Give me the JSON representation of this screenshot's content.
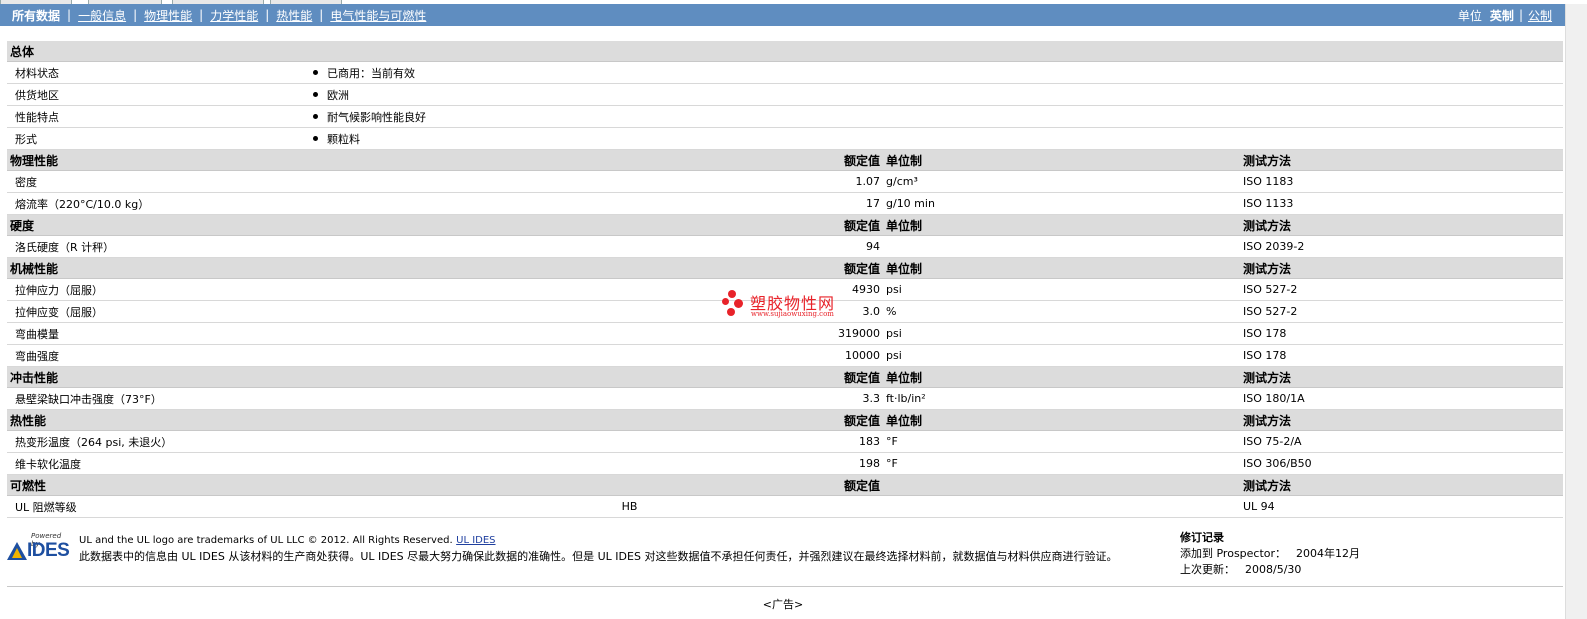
{
  "nav": {
    "tabs": [
      "所有数据",
      "一般信息",
      "物理性能",
      "力学性能",
      "热性能",
      "电气性能与可燃性"
    ],
    "units_label": "单位",
    "unit_current": "英制",
    "unit_other": "公制"
  },
  "sections": [
    {
      "title": "总体",
      "headers": null,
      "rows": [
        {
          "label": "材料状态",
          "bullet": "已商用：当前有效"
        },
        {
          "label": "供货地区",
          "bullet": "欧洲"
        },
        {
          "label": "性能特点",
          "bullet": "耐气候影响性能良好"
        },
        {
          "label": "形式",
          "bullet": "颗粒料"
        }
      ]
    },
    {
      "title": "物理性能",
      "headers": {
        "value": "额定值",
        "unit": "单位制",
        "method": "测试方法"
      },
      "rows": [
        {
          "label": "密度",
          "value": "1.07",
          "unit": "g/cm³",
          "method": "ISO 1183"
        },
        {
          "label": "熔流率（220°C/10.0 kg）",
          "value": "17",
          "unit": "g/10 min",
          "method": "ISO 1133"
        }
      ]
    },
    {
      "title": "硬度",
      "headers": {
        "value": "额定值",
        "unit": "单位制",
        "method": "测试方法"
      },
      "rows": [
        {
          "label": "洛氏硬度（R 计秤）",
          "value": "94",
          "unit": "",
          "method": "ISO 2039-2"
        }
      ]
    },
    {
      "title": "机械性能",
      "headers": {
        "value": "额定值",
        "unit": "单位制",
        "method": "测试方法"
      },
      "rows": [
        {
          "label": "拉伸应力（屈服）",
          "value": "4930",
          "unit": "psi",
          "method": "ISO 527-2"
        },
        {
          "label": "拉伸应变（屈服）",
          "value": "3.0",
          "unit": "%",
          "method": "ISO 527-2"
        },
        {
          "label": "弯曲模量",
          "value": "319000",
          "unit": "psi",
          "method": "ISO 178"
        },
        {
          "label": "弯曲强度",
          "value": "10000",
          "unit": "psi",
          "method": "ISO 178"
        }
      ]
    },
    {
      "title": "冲击性能",
      "headers": {
        "value": "额定值",
        "unit": "单位制",
        "method": "测试方法"
      },
      "rows": [
        {
          "label": "悬壁梁缺口冲击强度（73°F）",
          "value": "3.3",
          "unit": "ft·lb/in²",
          "method": "ISO 180/1A"
        }
      ]
    },
    {
      "title": "热性能",
      "headers": {
        "value": "额定值",
        "unit": "单位制",
        "method": "测试方法"
      },
      "rows": [
        {
          "label": "热变形温度（264 psi, 未退火）",
          "value": "183",
          "unit": "°F",
          "method": "ISO 75-2/A"
        },
        {
          "label": "维卡软化温度",
          "value": "198",
          "unit": "°F",
          "method": "ISO 306/B50"
        }
      ]
    },
    {
      "title": "可燃性",
      "headers": {
        "value": "额定值",
        "unit": "",
        "method": "测试方法"
      },
      "rows": [
        {
          "label": "UL 阻燃等级",
          "value": "HB",
          "unit": "",
          "method": "UL 94",
          "value_center": true
        }
      ]
    }
  ],
  "footer": {
    "logo_powered": "Powered by",
    "logo_word": "IDES",
    "trademark": "UL and the UL logo are trademarks of UL LLC © 2012. All Rights Reserved.",
    "link": "UL IDES",
    "disclaimer": "此数据表中的信息由 UL IDES 从该材料的生产商处获得。UL IDES 尽最大努力确保此数据的准确性。但是 UL IDES 对这些数据值不承担任何责任，并强烈建议在最终选择材料前，就数据值与材料供应商进行验证。",
    "revision_title": "修订记录",
    "added_label": "添加到 Prospector：",
    "added_value": "2004年12月",
    "updated_label": "上次更新：",
    "updated_value": "2008/5/30"
  },
  "ad_label": "<广告>",
  "watermark": {
    "name": "塑胶物性网",
    "url": "www.sujiaowuxing.com",
    "color": "#e8232a"
  },
  "colors": {
    "navbar": "#5f8dc0",
    "section_header": "#dcdcdc",
    "logo_blue": "#1e4fa0"
  }
}
